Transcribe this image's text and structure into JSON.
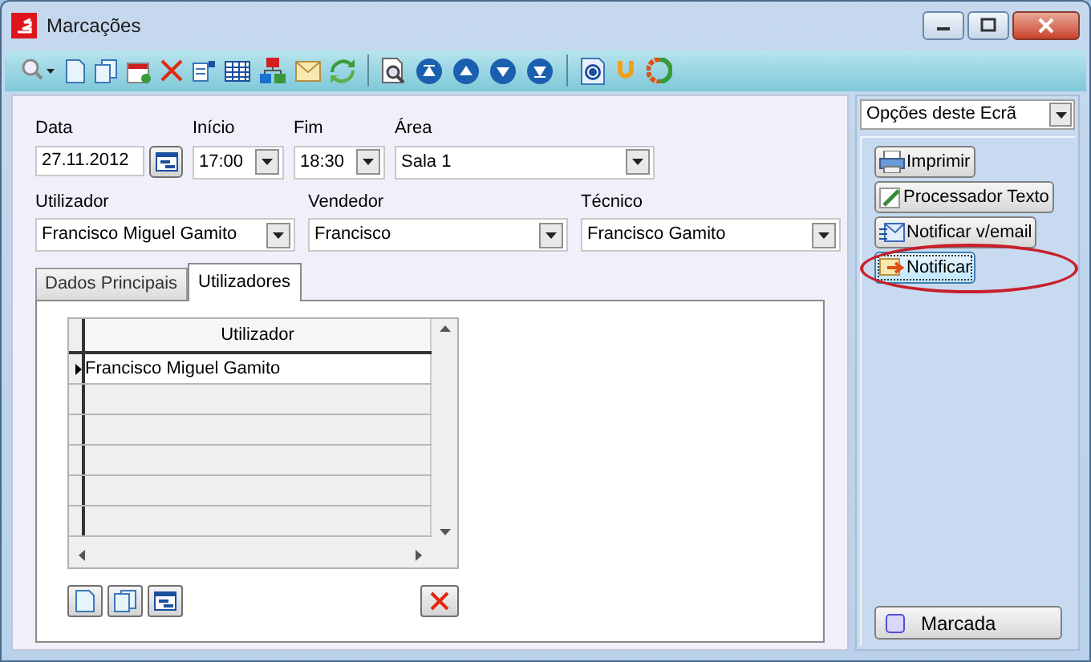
{
  "window": {
    "title": "Marcações"
  },
  "form": {
    "data": {
      "label": "Data",
      "value": "27.11.2012"
    },
    "inicio": {
      "label": "Início",
      "value": "17:00"
    },
    "fim": {
      "label": "Fim",
      "value": "18:30"
    },
    "area": {
      "label": "Área",
      "value": "Sala 1"
    },
    "combos": [
      {
        "label": "Utilizador",
        "value": "Francisco Miguel Gamito"
      },
      {
        "label": "Vendedor",
        "value": "Francisco"
      },
      {
        "label": "Técnico",
        "value": "Francisco Gamito"
      }
    ]
  },
  "tabs": [
    {
      "label": "Dados Principais",
      "selected": false
    },
    {
      "label": "Utilizadores",
      "selected": true
    }
  ],
  "grid": {
    "columns": [
      "Utilizador"
    ],
    "rows": [
      {
        "cells": [
          "Francisco Miguel Gamito"
        ],
        "current": true
      }
    ]
  },
  "side": {
    "dropdown": "Opções deste Ecrã",
    "buttons": [
      {
        "label": "Imprimir",
        "focused": false,
        "circled": false
      },
      {
        "label": "Processador Texto",
        "focused": false,
        "circled": false
      },
      {
        "label": "Notificar v/email",
        "focused": false,
        "circled": false
      },
      {
        "label": "Notificar",
        "focused": true,
        "circled": true
      }
    ],
    "status_button": "Marcada"
  }
}
